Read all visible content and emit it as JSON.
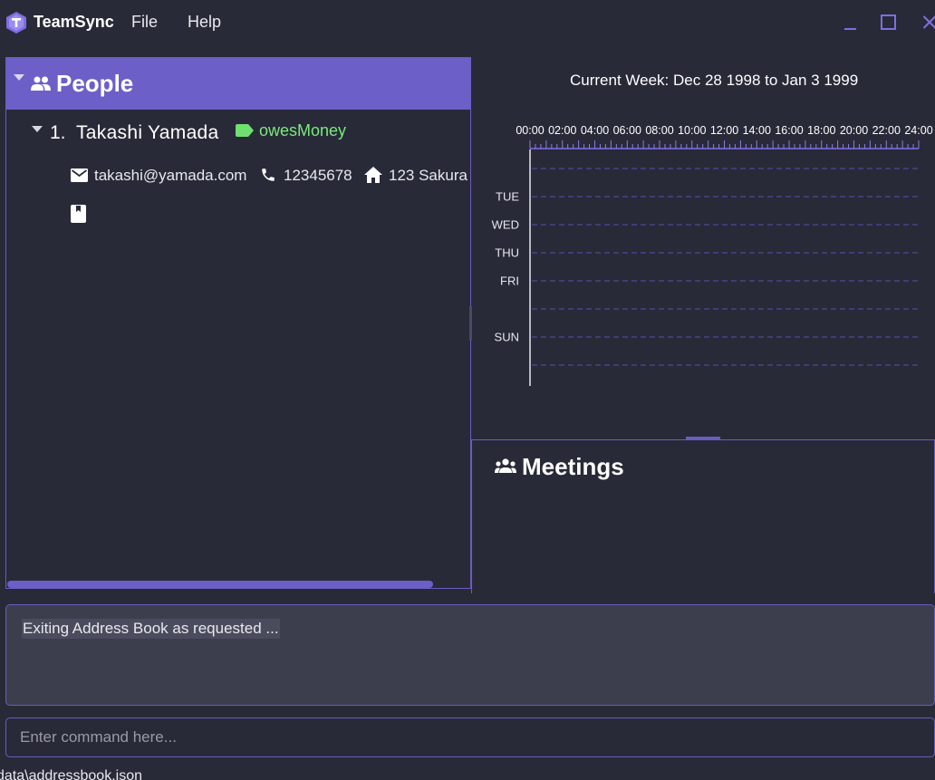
{
  "app": {
    "name": "TeamSync",
    "accent": "#6c5fc7",
    "background": "#282a38"
  },
  "menu": {
    "file": "File",
    "help": "Help"
  },
  "window_controls": {
    "minimize_icon": "minimize-icon",
    "maximize_icon": "maximize-icon",
    "close_icon": "close-icon"
  },
  "people": {
    "title": "People",
    "persons": [
      {
        "index": "1.",
        "name": "Takashi Yamada",
        "tags": [
          "owesMoney"
        ],
        "email": "takashi@yamada.com",
        "phone": "12345678",
        "address": "123 Sakura",
        "tag_color": "#7bea7b"
      }
    ]
  },
  "schedule": {
    "week_label": "Current Week: Dec 28 1998 to Jan 3 1999",
    "hour_labels": [
      "00:00",
      "02:00",
      "04:00",
      "06:00",
      "08:00",
      "10:00",
      "12:00",
      "14:00",
      "16:00",
      "18:00",
      "20:00",
      "22:00",
      "24:00"
    ],
    "day_labels": [
      "",
      "TUE",
      "WED",
      "THU",
      "FRI",
      "",
      "SUN"
    ]
  },
  "meetings": {
    "title": "Meetings"
  },
  "result": {
    "text": "Exiting Address Book as requested ..."
  },
  "command": {
    "placeholder": "Enter command here...",
    "value": ""
  },
  "status": {
    "path": "data\\addressbook.json"
  }
}
